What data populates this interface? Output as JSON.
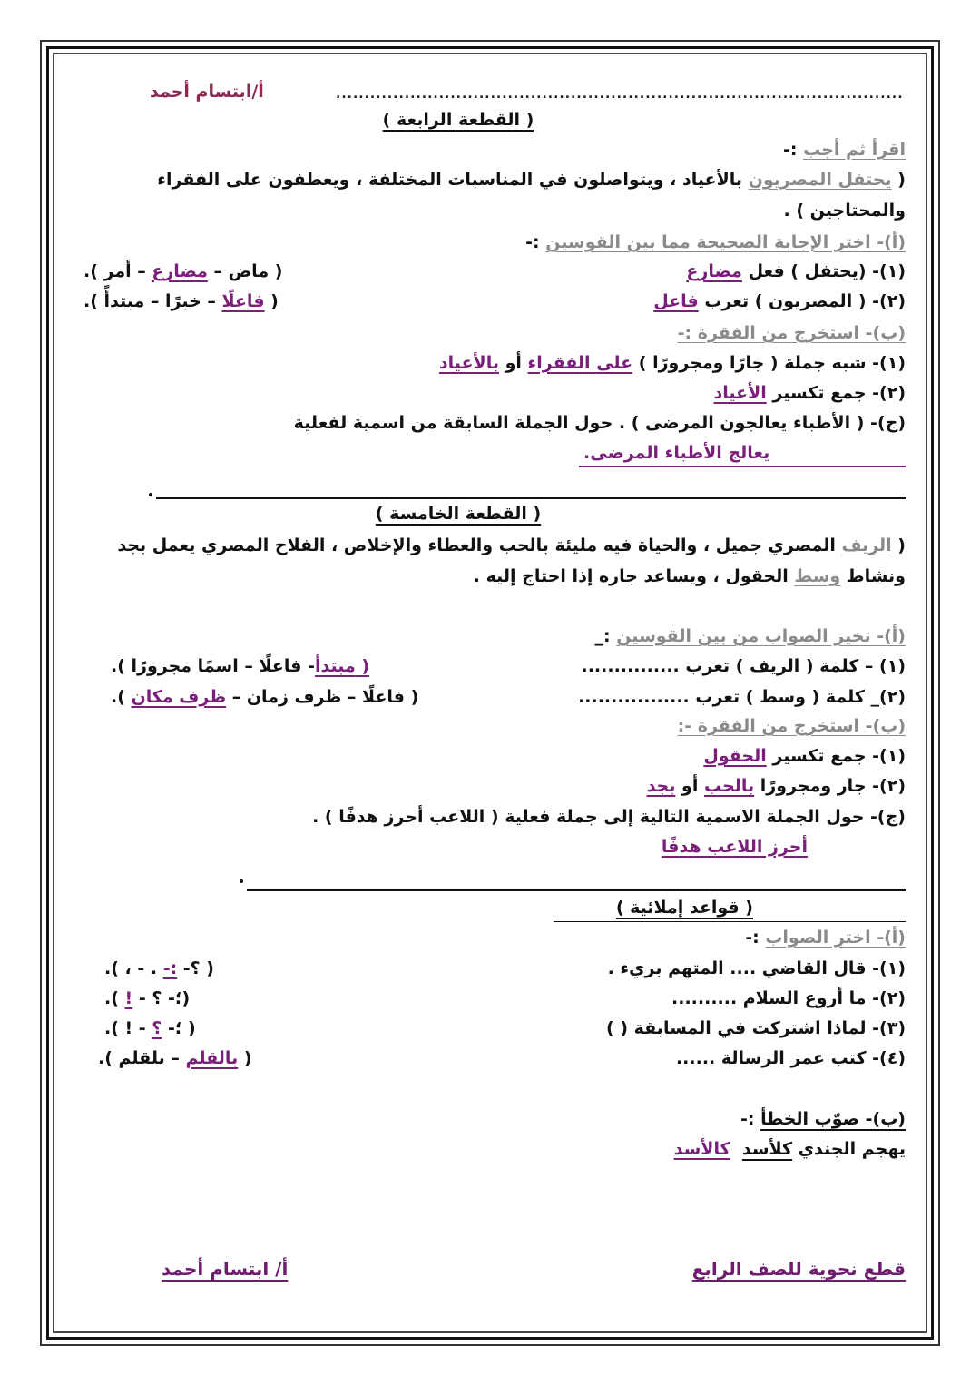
{
  "header": {
    "author": "أ/ابتسام أحمد",
    "dots": "............................................................................................................................................"
  },
  "passage4": {
    "title": "( القطعة الرابعة )",
    "instruction": "اقرأ ثم أجب",
    "instruction_suffix": " :-",
    "text_open": "( ",
    "text_underlined": "يحتفل المصريون",
    "text_line1_rest": " بالأعياد ، ويتواصلون في المناسبات المختلفة ، ويعطفون على الفقراء",
    "text_line2": "والمحتاجين ) .",
    "part_a": {
      "heading": "(أ)- اختر الإجابة الصحيحة مما بين القوسين",
      "heading_suffix": " :-",
      "items": [
        {
          "num": "(١)- ",
          "question": "(يحتفل ) فعل ",
          "answer": "مضارع",
          "options_open": "( ماض – ",
          "options_answer": "مضارع",
          "options_close": " – أمر )."
        },
        {
          "num": "(٢)- ",
          "question": "( المصريون ) تعرب ",
          "answer": "فاعل",
          "options_open": "( ",
          "options_answer": "فاعلًا",
          "options_close": " – خبرًا – مبتدأً )."
        }
      ]
    },
    "part_b": {
      "heading": "(ب)- استخرج من الفقرة :-",
      "items": [
        {
          "num": "(١)- ",
          "question": "شبه جملة ( جارًا ومجرورًا )  ",
          "answer": "على الفقراء",
          "sep": "  أو ",
          "answer2": "بالأعياد"
        },
        {
          "num": "(٢)- ",
          "question": "جمع تكسير  ",
          "answer": "الأعياد"
        }
      ]
    },
    "part_c": {
      "question": "(ج)- ( الأطباء يعالجون المرضى ) . حول الجملة السابقة من اسمية لفعلية",
      "answer": "يعالج الأطباء المرضى."
    }
  },
  "passage5": {
    "title": "( القطعة الخامسة )",
    "text_open": "( ",
    "word1": "الريف",
    "text_line1_rest": " المصري جميل ، والحياة فيه مليئة بالحب والعطاء والإخلاص ، الفلاح المصري يعمل بجد",
    "text_line2_a": "ونشاط ",
    "word2": "وسط",
    "text_line2_b": " الحقول ، ويساعد جاره إذا احتاج إليه .",
    "part_a": {
      "heading": "(أ)- تخير الصواب من بين القوسين",
      "heading_suffix": " :_",
      "items": [
        {
          "num": "(١) ",
          "question": "– كلمة ( الريف ) تعرب ...............",
          "options_open": "( ",
          "options_answer": "مبتدأ",
          "options_close": "- فاعلًا – اسمًا مجرورًا )."
        },
        {
          "num": "(٢)_ ",
          "question": "كلمة ( وسط ) تعرب .................",
          "options_open": "( فاعلًا – ظرف زمان – ",
          "options_answer": "ظرف مكان",
          "options_close": " )."
        }
      ]
    },
    "part_b": {
      "heading": "(ب)- استخرج من الفقرة  -:",
      "items": [
        {
          "num": "(١)- ",
          "question": "جمع تكسير  ",
          "answer": "الحقول"
        },
        {
          "num": "(٢)- ",
          "question": "جار ومجرورًا ",
          "answer": "بالحب",
          "sep": " أو ",
          "answer2": "بجد"
        }
      ]
    },
    "part_c": {
      "question": "(ج)- حول الجملة الاسمية التالية إلى جملة فعلية ( اللاعب أحرز هدفًا )  .",
      "answer": "أحرز اللاعب هدفًا"
    }
  },
  "spelling": {
    "title": "( قواعد إملائية )",
    "part_a": {
      "heading": "(أ)- اختر الصواب",
      "heading_suffix": " :-",
      "items": [
        {
          "num": "(١)-  ",
          "question": "قال القاضي .... المتهم بريء .",
          "options_open": "( ؟- ",
          "options_answer": ":-",
          "options_close": " . - ، )."
        },
        {
          "num": "(٢)-  ",
          "question": "ما أروع السلام ..........",
          "options_open": "(؛- ؟ - ",
          "options_answer": "!",
          "options_close": " )."
        },
        {
          "num": "(٣)- ",
          "question": "لماذا اشتركت في المسابقة (  )",
          "options_open": "( ؛- ",
          "options_answer": "؟",
          "options_close": " - ! )."
        },
        {
          "num": "(٤)- ",
          "question": "كتب عمر الرسالة ......",
          "options_open": "( ",
          "options_answer": "بالقلم",
          "options_close": " – بلقلم )."
        }
      ]
    },
    "part_b": {
      "heading": "(ب)- صوّب الخطأ",
      "heading_suffix": " :-",
      "sentence": "يهجم الجندي ",
      "wrong": "كلأسد",
      "correct": "كالأسد"
    }
  },
  "footer": {
    "left": "أ/ ابتسام أحمد",
    "right": "قطع نحوية للصف الرابع "
  },
  "colors": {
    "answer": "#7a1f7a",
    "author": "#8b2a52",
    "heading_gray": "#8a8a8a"
  }
}
